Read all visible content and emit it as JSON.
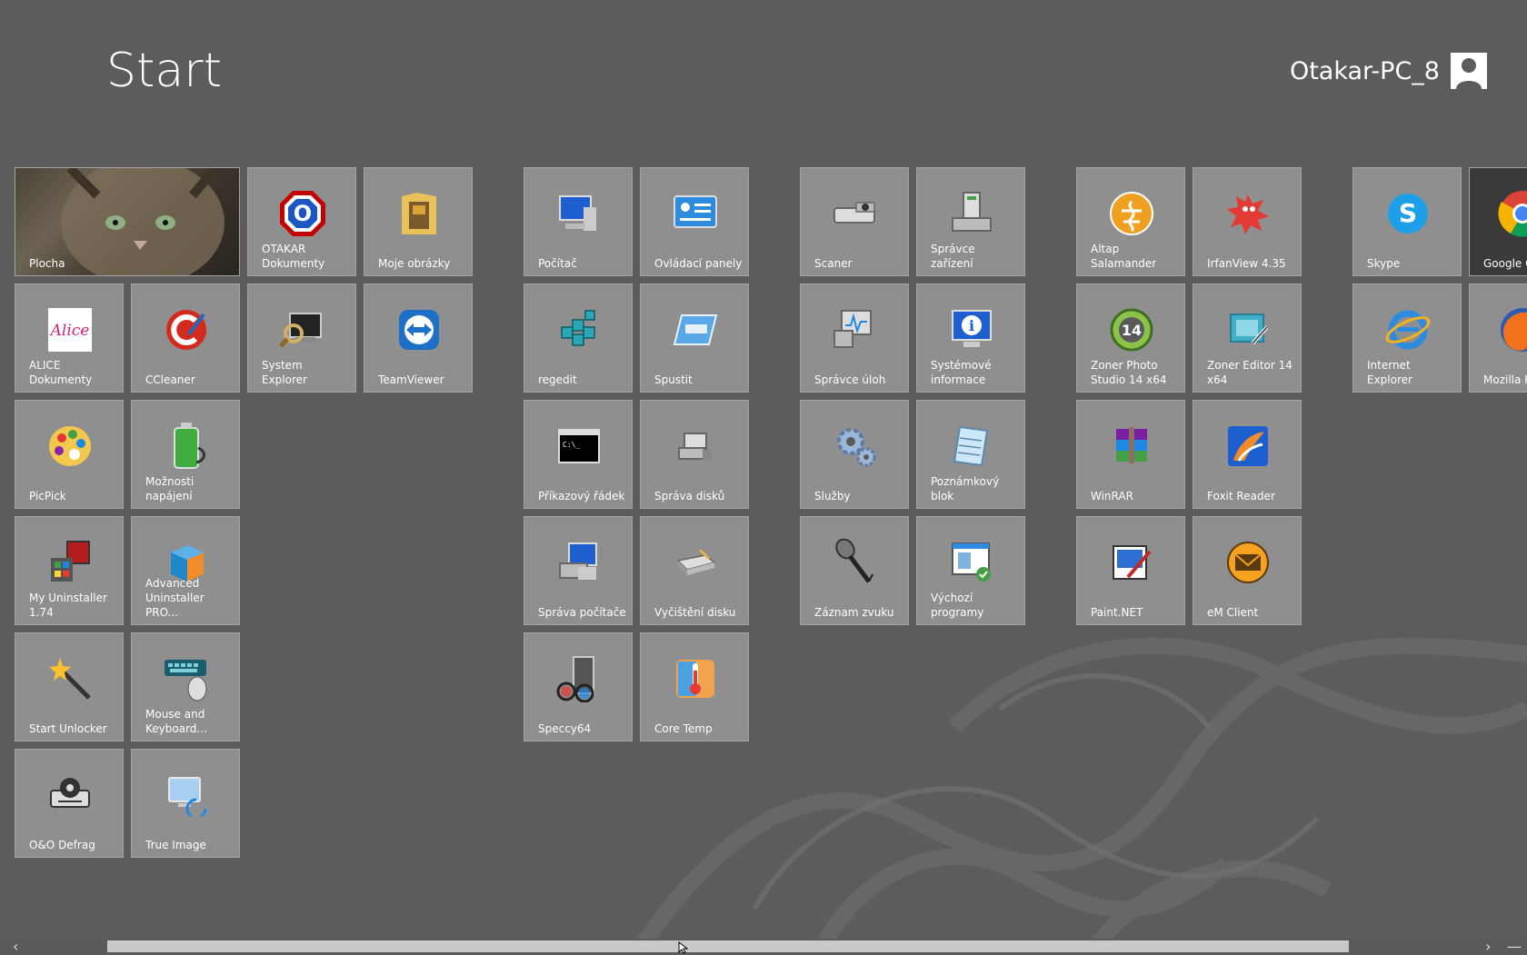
{
  "header": {
    "title": "Start",
    "user_name": "Otakar-PC_8"
  },
  "tiles": [
    {
      "id": "plocha",
      "label": "Plocha",
      "icon": "cat-photo"
    },
    {
      "id": "otakar",
      "label": "OTAKAR Dokumenty",
      "icon": "octagon-o-icon"
    },
    {
      "id": "moje",
      "label": "Moje obrázky",
      "icon": "folder-pictures-icon"
    },
    {
      "id": "alice",
      "label": "ALICE Dokumenty",
      "icon": "alice-icon"
    },
    {
      "id": "ccleaner",
      "label": "CCleaner",
      "icon": "ccleaner-icon"
    },
    {
      "id": "sysexp",
      "label": "System Explorer",
      "icon": "system-explorer-icon"
    },
    {
      "id": "teamviewer",
      "label": "TeamViewer",
      "icon": "teamviewer-icon"
    },
    {
      "id": "picpick",
      "label": "PicPick",
      "icon": "palette-icon"
    },
    {
      "id": "moznosti",
      "label": "Možnosti napájení",
      "icon": "battery-icon"
    },
    {
      "id": "myunins",
      "label": "My Uninstaller 1.74",
      "icon": "uninstaller-icon"
    },
    {
      "id": "advunins",
      "label": "Advanced Uninstaller PRO...",
      "icon": "box-icon"
    },
    {
      "id": "startunlock",
      "label": "Start Unlocker",
      "icon": "magic-wand-icon"
    },
    {
      "id": "mousekb",
      "label": "Mouse and Keyboard...",
      "icon": "keyboard-mouse-icon"
    },
    {
      "id": "oodefrag",
      "label": "O&O Defrag",
      "icon": "defrag-icon"
    },
    {
      "id": "trueimage",
      "label": "True Image",
      "icon": "computer-backup-icon"
    },
    {
      "id": "pocitac",
      "label": "Počítač",
      "icon": "computer-icon"
    },
    {
      "id": "ovladaci",
      "label": "Ovládací panely",
      "icon": "control-panel-icon"
    },
    {
      "id": "regedit",
      "label": "regedit",
      "icon": "registry-icon"
    },
    {
      "id": "spustit",
      "label": "Spustit",
      "icon": "run-icon"
    },
    {
      "id": "prikazovy",
      "label": "Příkazový řádek",
      "icon": "cmd-icon"
    },
    {
      "id": "spravadisku",
      "label": "Správa disků",
      "icon": "disk-management-icon"
    },
    {
      "id": "spravapocitace",
      "label": "Správa počítače",
      "icon": "computer-management-icon"
    },
    {
      "id": "vycisteni",
      "label": "Vyčištění disku",
      "icon": "disk-cleanup-icon"
    },
    {
      "id": "speccy",
      "label": "Speccy64",
      "icon": "speccy-icon"
    },
    {
      "id": "coretemp",
      "label": "Core Temp",
      "icon": "thermometer-icon"
    },
    {
      "id": "scaner",
      "label": "Scaner",
      "icon": "scanner-icon"
    },
    {
      "id": "spravcezar",
      "label": "Správce zařízení",
      "icon": "device-manager-icon"
    },
    {
      "id": "spravceuloh",
      "label": "Správce úloh",
      "icon": "task-manager-icon"
    },
    {
      "id": "sysinfo",
      "label": "Systémové informace",
      "icon": "system-info-icon"
    },
    {
      "id": "sluzby",
      "label": "Služby",
      "icon": "gears-icon"
    },
    {
      "id": "poznamkovy",
      "label": "Poznámkový blok",
      "icon": "notepad-icon"
    },
    {
      "id": "zaznam",
      "label": "Záznam zvuku",
      "icon": "microphone-icon"
    },
    {
      "id": "vychozi",
      "label": "Výchozí programy",
      "icon": "default-programs-icon"
    },
    {
      "id": "altap",
      "label": "Altap Salamander",
      "icon": "salamander-icon"
    },
    {
      "id": "irfan",
      "label": "IrfanView 4.35",
      "icon": "irfanview-icon"
    },
    {
      "id": "zonerps",
      "label": "Zoner Photo Studio 14 x64",
      "icon": "zoner-photo-icon"
    },
    {
      "id": "zonered",
      "label": "Zoner Editor 14 x64",
      "icon": "zoner-editor-icon"
    },
    {
      "id": "winrar",
      "label": "WinRAR",
      "icon": "winrar-icon"
    },
    {
      "id": "foxit",
      "label": "Foxit Reader",
      "icon": "foxit-icon"
    },
    {
      "id": "paintnet",
      "label": "Paint.NET",
      "icon": "paintnet-icon"
    },
    {
      "id": "emclient",
      "label": "eM Client",
      "icon": "emclient-icon"
    },
    {
      "id": "skype",
      "label": "Skype",
      "icon": "skype-icon"
    },
    {
      "id": "chrome",
      "label": "Google C",
      "icon": "chrome-icon"
    },
    {
      "id": "ie",
      "label": "Internet Explorer",
      "icon": "ie-icon"
    },
    {
      "id": "firefox",
      "label": "Mozilla Fi",
      "icon": "firefox-icon"
    }
  ],
  "colors": {
    "background": "#5c5c5c",
    "tile": "#8f8f8f",
    "accent": "#ffffff"
  }
}
